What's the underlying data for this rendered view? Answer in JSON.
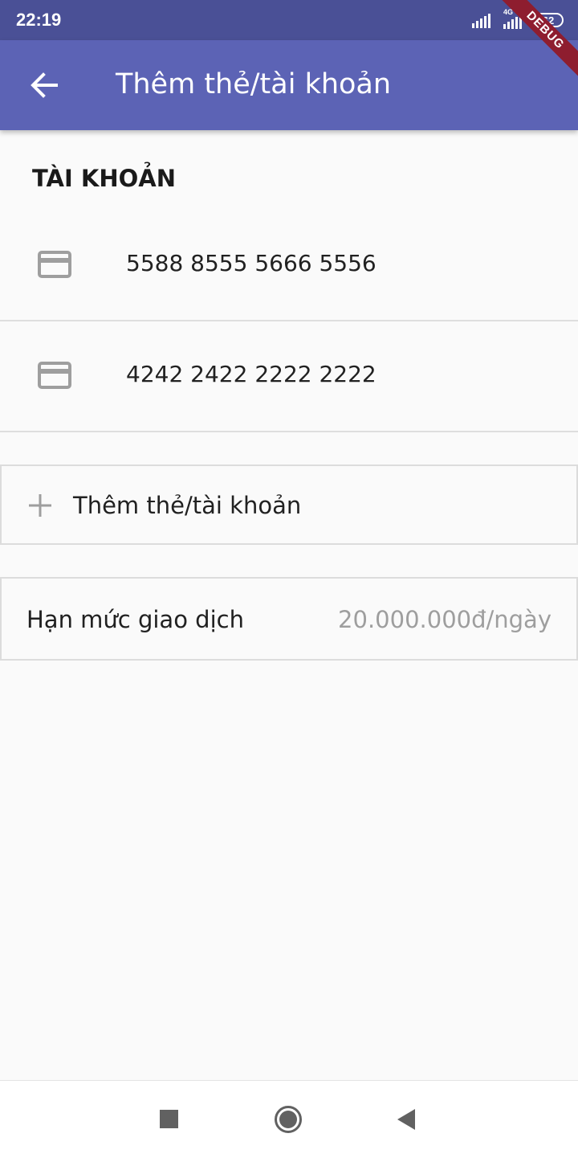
{
  "status_bar": {
    "time": "22:19",
    "network_type": "4G",
    "battery": "62",
    "icons": [
      "signal-icon",
      "signal-4g-icon",
      "battery-icon"
    ]
  },
  "debug_banner": "DEBUG",
  "app_bar": {
    "title": "Thêm thẻ/tài khoản",
    "back_icon": "arrow-back-icon"
  },
  "accounts_section": {
    "title": "TÀI KHOẢN",
    "items": [
      {
        "icon": "credit-card-icon",
        "number": "5588 8555 5666 5556"
      },
      {
        "icon": "credit-card-icon",
        "number": "4242 2422 2222 2222"
      }
    ]
  },
  "add_account": {
    "icon": "plus-icon",
    "label": "Thêm thẻ/tài khoản"
  },
  "transaction_limit": {
    "label": "Hạn mức giao dịch",
    "value": "20.000.000đ/ngày"
  },
  "nav_bar": {
    "icons": [
      "recents-square-icon",
      "home-circle-icon",
      "back-triangle-icon"
    ]
  },
  "colors": {
    "status_bar": "#4a5096",
    "app_bar": "#5c63b5",
    "background": "#fafafa",
    "debug_ribbon": "#8e1d2f",
    "primary_text": "#212121",
    "secondary_text": "#9e9e9e",
    "icon_gray": "#9e9e9e"
  }
}
